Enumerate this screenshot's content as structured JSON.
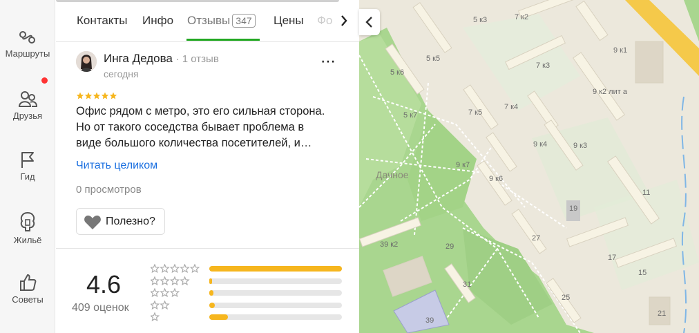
{
  "rail": {
    "items": [
      {
        "label": "Маршруты",
        "icon": "routes-icon"
      },
      {
        "label": "Друзья",
        "icon": "friends-icon"
      },
      {
        "label": "Гид",
        "icon": "flag-icon"
      },
      {
        "label": "Жильё",
        "icon": "housing-icon"
      },
      {
        "label": "Советы",
        "icon": "thumbs-up-icon"
      }
    ]
  },
  "tabs": {
    "items": [
      "Контакты",
      "Инфо",
      "Отзывы",
      "Цены",
      "Фо"
    ],
    "active": "Отзывы",
    "reviews_count": "347"
  },
  "review": {
    "author": "Инга Дедова",
    "author_meta": "· 1 отзыв",
    "date": "сегодня",
    "rating": 5,
    "text": "Офис рядом с метро, это его сильная сторона. Но от такого соседства бывает проблема в виде большого количества посетителей, и…",
    "read_more": "Читать целиком",
    "views": "0 просмотров",
    "useful_label": "Полезно?"
  },
  "summary": {
    "score": "4.6",
    "count_label": "409 оценок",
    "distribution": [
      {
        "stars": 5,
        "fraction": 1.0
      },
      {
        "stars": 4,
        "fraction": 0.02
      },
      {
        "stars": 3,
        "fraction": 0.03
      },
      {
        "stars": 2,
        "fraction": 0.04
      },
      {
        "stars": 1,
        "fraction": 0.14
      }
    ]
  },
  "colors": {
    "accent_green": "#22a722",
    "link_blue": "#1a6fe0",
    "star_orange": "#f6b61e",
    "map_park": "#a9d68f",
    "map_building": "#f7f3e4",
    "map_road": "#f5c94a"
  },
  "map": {
    "labels": [
      "5 к3",
      "7 к2",
      "9 к1",
      "5 к5",
      "5 к6",
      "7 к3",
      "9 к2 лит а",
      "5 к7",
      "7 к5",
      "7 к4",
      "9 к4",
      "9 к3",
      "9 к7",
      "9 к6",
      "Дачное",
      "11",
      "19",
      "39 к2",
      "29",
      "27",
      "17",
      "15",
      "31",
      "25",
      "39",
      "21"
    ]
  }
}
